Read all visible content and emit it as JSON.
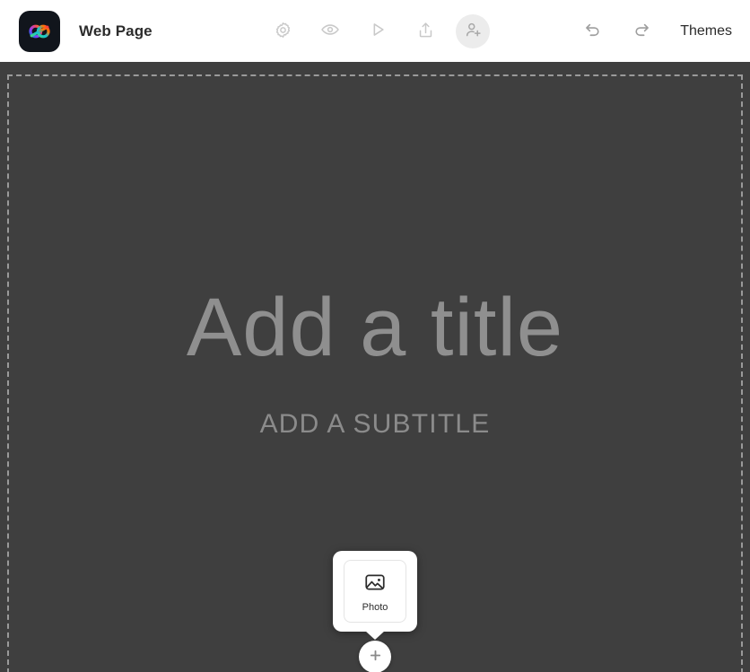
{
  "header": {
    "logo_icon": "adobe-express-logo",
    "document_title": "Web Page",
    "tools": [
      {
        "icon": "gear-icon",
        "label": "Settings",
        "active": false
      },
      {
        "icon": "eye-icon",
        "label": "Preview",
        "active": false
      },
      {
        "icon": "play-icon",
        "label": "Present",
        "active": false
      },
      {
        "icon": "share-icon",
        "label": "Share",
        "active": false
      },
      {
        "icon": "add-person-icon",
        "label": "Invite",
        "active": true
      }
    ],
    "undo_icon": "undo-icon",
    "redo_icon": "redo-icon",
    "themes_label": "Themes"
  },
  "canvas": {
    "background_color": "#3f3f3f",
    "title_placeholder": "Add a title",
    "subtitle_placeholder": "ADD A SUBTITLE",
    "placeholder_color": "#8f8f8f"
  },
  "popover": {
    "items": [
      {
        "icon": "photo-icon",
        "label": "Photo"
      }
    ]
  },
  "add_button": {
    "icon": "plus-icon",
    "label": "Add content"
  }
}
